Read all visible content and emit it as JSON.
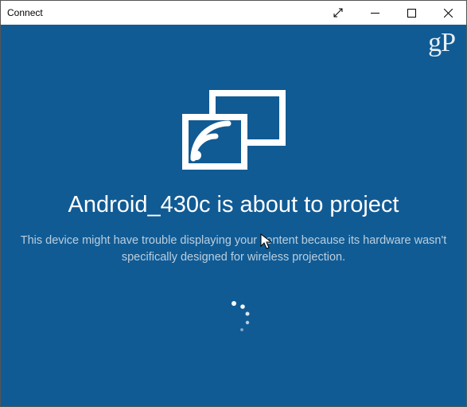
{
  "window": {
    "title": "Connect"
  },
  "watermark": "gP",
  "main": {
    "headline": "Android_430c is about to project",
    "subtext": "This device might have trouble displaying your content because its hardware wasn't specifically designed for wireless projection."
  }
}
